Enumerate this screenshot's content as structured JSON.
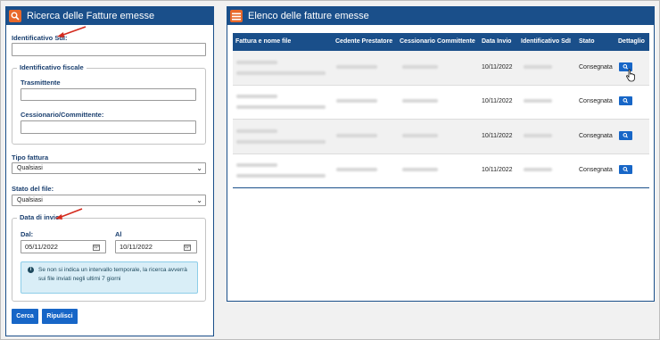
{
  "search_panel": {
    "title": "Ricerca delle Fatture emesse",
    "icon": "search-icon",
    "sdi_label": "Identificativo SdI:",
    "sdi_value": "",
    "fiscal_group": {
      "legend": "Identificativo fiscale",
      "trasmittente_label": "Trasmittente",
      "trasmittente_value": "",
      "cessionario_label": "Cessionario/Committente:",
      "cessionario_value": ""
    },
    "tipo_fattura_label": "Tipo fattura",
    "tipo_fattura_value": "Qualsiasi",
    "stato_file_label": "Stato del file:",
    "stato_file_value": "Qualsiasi",
    "date_group": {
      "legend": "Data di invio",
      "dal_label": "Dal:",
      "dal_value": "05/11/2022",
      "al_label": "Al",
      "al_value": "10/11/2022",
      "info_text": "Se non si indica un intervallo temporale, la ricerca avverrà sui file inviati negli ultimi 7 giorni"
    },
    "search_button": "Cerca",
    "reset_button": "Ripulisci"
  },
  "results_panel": {
    "title": "Elenco delle fatture emesse",
    "icon": "list-icon",
    "columns": [
      "Fattura e nome file",
      "Cedente Prestatore",
      "Cessionario Committente",
      "Data Invio",
      "Identificativo SdI",
      "Stato",
      "Dettaglio"
    ],
    "rows": [
      {
        "data_invio": "10/11/2022",
        "stato": "Consegnata"
      },
      {
        "data_invio": "10/11/2022",
        "stato": "Consegnata"
      },
      {
        "data_invio": "10/11/2022",
        "stato": "Consegnata"
      },
      {
        "data_invio": "10/11/2022",
        "stato": "Consegnata"
      }
    ]
  },
  "colors": {
    "header_blue": "#1a4f8a",
    "button_blue": "#1766c7",
    "icon_orange": "#e8682a",
    "annotation_red": "#d42b1e",
    "info_bg": "#d9eef7"
  }
}
